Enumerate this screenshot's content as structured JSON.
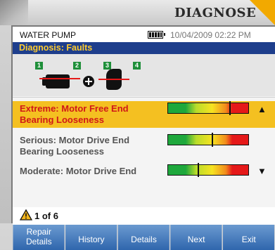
{
  "brand": "DIAGNOSE",
  "app": {
    "title": "WATER PUMP",
    "datetime": "10/04/2009 02:22 PM"
  },
  "header": "Diagnosis: Faults",
  "diagram": {
    "points": [
      "1",
      "2",
      "3",
      "4"
    ]
  },
  "faults": [
    {
      "line1": "Extreme: Motor Free End",
      "line2": "Bearing Looseness",
      "severity": 0.77,
      "selected": true
    },
    {
      "line1": "Serious: Motor Drive End",
      "line2": "Bearing Looseness",
      "severity": 0.55,
      "selected": false
    },
    {
      "line1": "Moderate: Motor Drive End",
      "line2": "",
      "severity": 0.37,
      "selected": false
    }
  ],
  "scroll": {
    "up": "▲",
    "down": "▼"
  },
  "pager": {
    "icon": "warning-icon",
    "text": "1 of 6"
  },
  "softkeys": [
    "Repair Details",
    "History",
    "Details",
    "Next",
    "Exit"
  ]
}
